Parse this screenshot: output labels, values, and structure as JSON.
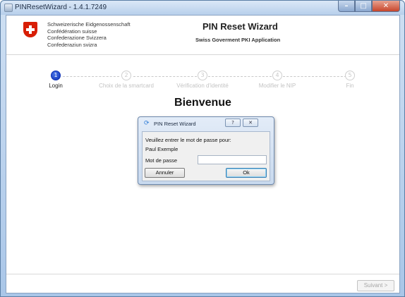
{
  "window": {
    "title": "PINResetWizard - 1.4.1.7249",
    "controls": {
      "minimize": "–",
      "maximize": "□",
      "close": "✕"
    }
  },
  "header": {
    "confederation": [
      "Schweizerische Eidgenossenschaft",
      "Confédération suisse",
      "Confederazione Svizzera",
      "Confederaziun svizra"
    ],
    "app_title": "PIN Reset Wizard",
    "app_subtitle": "Swiss Goverment PKI Application"
  },
  "steps": [
    {
      "number": "1",
      "label": "Login",
      "active": true
    },
    {
      "number": "2",
      "label": "Choix de la smartcard",
      "active": false
    },
    {
      "number": "3",
      "label": "Vérification d'identité",
      "active": false
    },
    {
      "number": "4",
      "label": "Modifier le NIP",
      "active": false
    },
    {
      "number": "5",
      "label": "Fin",
      "active": false
    }
  ],
  "welcome": "Bienvenue",
  "dialog": {
    "title": "PIN Reset Wizard",
    "help": "?",
    "close": "✕",
    "prompt": "Veuillez entrer le mot de passe pour:",
    "user": "Paul Exemple",
    "password_label": "Mot de passe",
    "password_value": "",
    "cancel_label": "Annuler",
    "ok_label": "Ok"
  },
  "footer": {
    "next_label": "Suivant >"
  },
  "colors": {
    "active_step": "#0b2fb5",
    "swiss_red": "#d81e05"
  }
}
